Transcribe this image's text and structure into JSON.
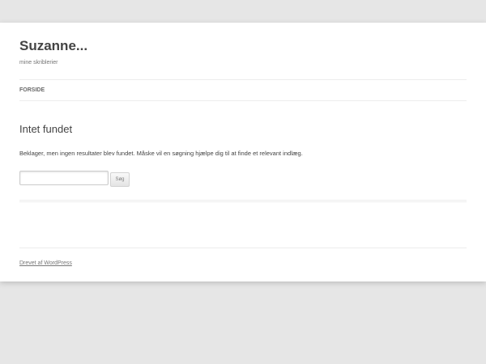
{
  "site": {
    "title": "Suzanne...",
    "description": "mine skriblerier"
  },
  "nav": {
    "items": [
      {
        "label": "FORSIDE"
      }
    ]
  },
  "content": {
    "title": "Intet fundet",
    "message": "Beklager, men ingen resultater blev fundet. Måske vil en søgning hjælpe dig til at finde et relevant indlæg."
  },
  "search": {
    "value": "",
    "button_label": "Søg"
  },
  "footer": {
    "credit": "Drevet af WordPress"
  }
}
